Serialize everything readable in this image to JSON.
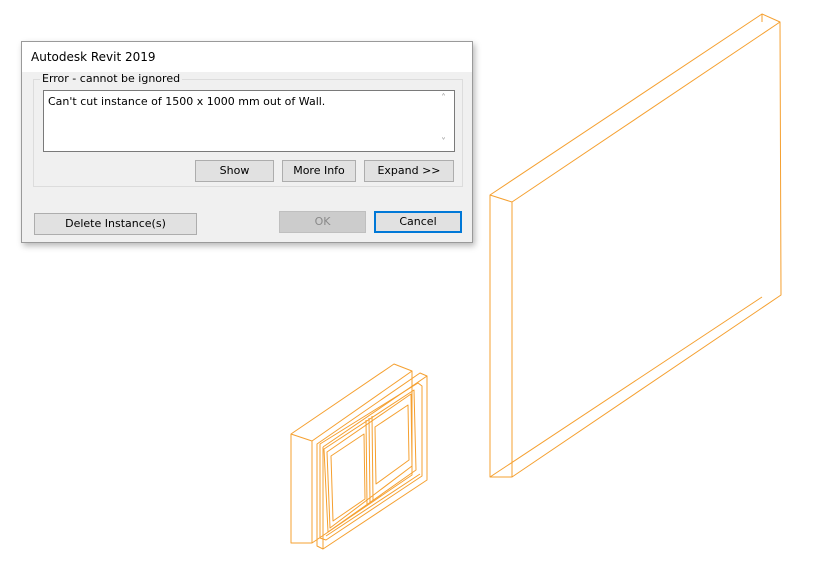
{
  "dialog": {
    "title": "Autodesk Revit 2019",
    "group_label": "Error - cannot be ignored",
    "message": "Can't cut instance of 1500 x 1000 mm out of Wall.",
    "buttons": {
      "show": "Show",
      "more_info": "More Info",
      "expand": "Expand >>",
      "delete_instances": "Delete Instance(s)",
      "ok": "OK",
      "cancel": "Cancel"
    }
  },
  "scrollbar": {
    "up_icon": "scroll-up-arrow",
    "down_icon": "scroll-down-arrow"
  },
  "colors": {
    "highlight_orange": "#f5a030",
    "default_button_border": "#0078d7"
  }
}
